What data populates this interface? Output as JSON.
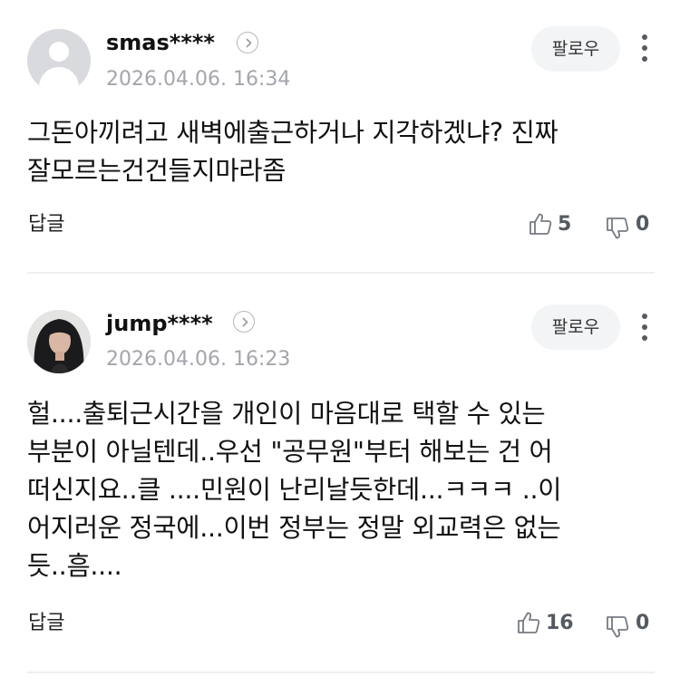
{
  "comments": [
    {
      "username": "smas****",
      "timestamp": "2026.04.06. 16:34",
      "follow_label": "팔로우",
      "body": "그돈아끼려고 새벽에출근하거나 지각하겠냐? 진짜\n잘모르는건건들지마라좀",
      "reply_label": "답글",
      "likes": "5",
      "dislikes": "0",
      "avatar": "default-avatar-icon"
    },
    {
      "username": "jump****",
      "timestamp": "2026.04.06. 16:23",
      "follow_label": "팔로우",
      "body": "헐....출퇴근시간을 개인이 마음대로 택할 수 있는\n부분이 아닐텐데..우선 \"공무원\"부터 해보는 건 어\n떠신지요..클 ....민원이 난리날듯한데...ㅋㅋㅋ ..이\n어지러운 정국에...이번 정부는 정말 외교력은 없는\n듯..흠....",
      "reply_label": "답글",
      "likes": "16",
      "dislikes": "0",
      "avatar": "user-photo-avatar"
    }
  ]
}
